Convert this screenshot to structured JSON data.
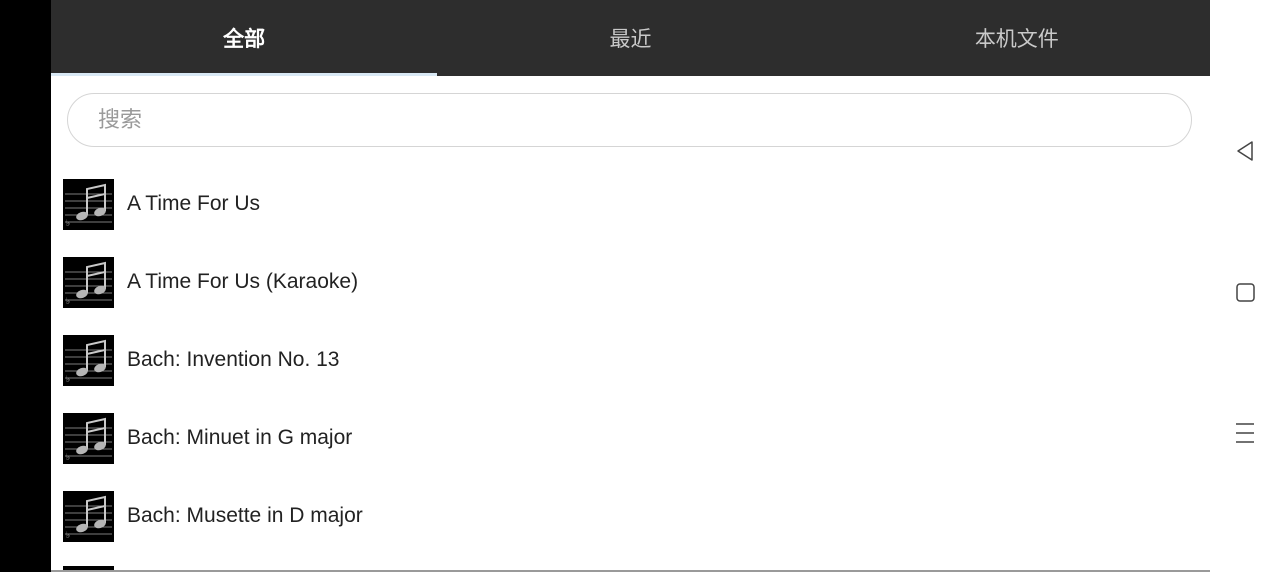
{
  "tabs": [
    {
      "label": "全部",
      "active": true
    },
    {
      "label": "最近",
      "active": false
    },
    {
      "label": "本机文件",
      "active": false
    }
  ],
  "search": {
    "placeholder": "搜索",
    "value": ""
  },
  "songs": [
    {
      "title": "A Time For Us"
    },
    {
      "title": "A Time For Us (Karaoke)"
    },
    {
      "title": "Bach: Invention No. 13"
    },
    {
      "title": "Bach: Minuet in G major"
    },
    {
      "title": "Bach: Musette in D major"
    }
  ],
  "colors": {
    "tab_bar": "#2d2d2d",
    "tab_indicator": "#d8e8f4",
    "active_tab_text": "#ffffff",
    "inactive_tab_text": "#c9c9c9"
  },
  "system_nav": {
    "icons": [
      "back-icon",
      "home-icon",
      "menu-icon"
    ]
  }
}
